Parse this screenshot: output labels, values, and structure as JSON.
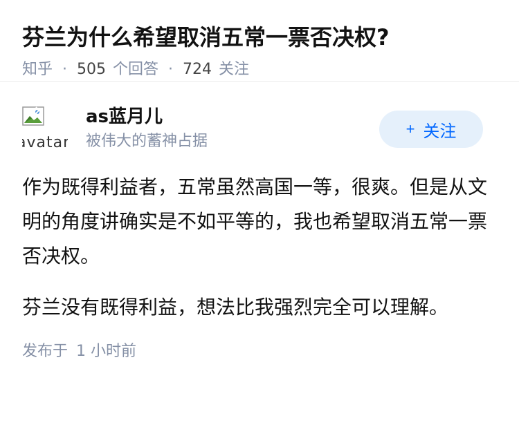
{
  "question": {
    "title": "芬兰为什么希望取消五常一票否决权?",
    "source": "知乎",
    "answer_count": "505",
    "answer_label": "个回答",
    "follow_count": "724",
    "follow_label": "关注"
  },
  "answer": {
    "author": {
      "avatar_alt": "avatar",
      "name": "as蓝月儿",
      "headline": "被伟大的蓄神占据"
    },
    "follow_button": {
      "icon": "+",
      "label": "关注"
    },
    "paragraphs": [
      "作为既得利益者，五常虽然高国一等，很爽。但是从文明的角度讲确实是不如平等的，我也希望取消五常一票否决权。",
      "芬兰没有既得利益，想法比我强烈完全可以理解。"
    ],
    "footer": {
      "published_label": "发布于",
      "time": "1 小时前"
    }
  },
  "colors": {
    "accent": "#0066ff",
    "accent_bg": "#e5f0fb",
    "meta_gray": "#8590a6",
    "text": "#121212"
  }
}
